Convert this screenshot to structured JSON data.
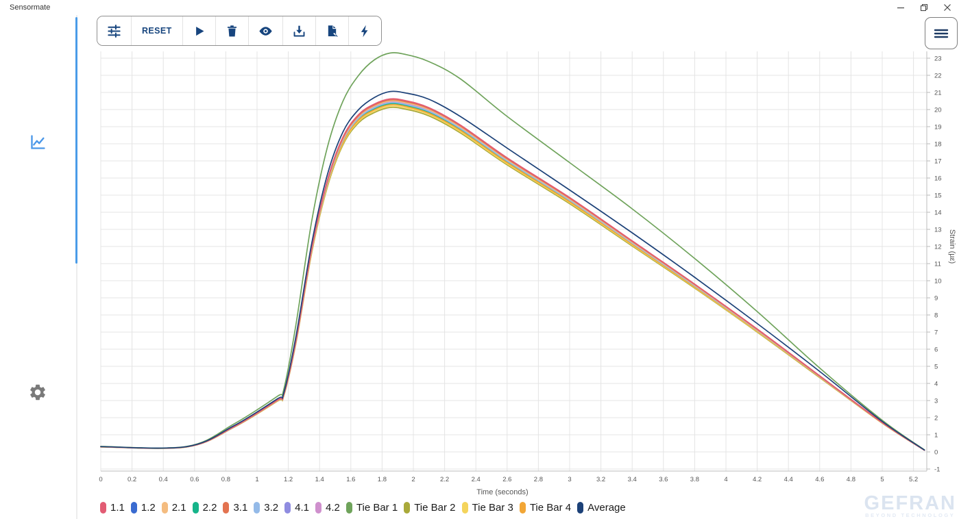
{
  "window": {
    "title": "Sensormate",
    "controls": {
      "minimize": "minimize",
      "restore": "restore-down",
      "close": "close"
    }
  },
  "sidebar": {
    "items": [
      {
        "id": "chart",
        "icon": "line-chart-icon",
        "active": true
      },
      {
        "id": "settings",
        "icon": "gear-icon",
        "active": false
      }
    ],
    "accent_color": "#4a9ce8"
  },
  "toolbar": {
    "reset_label": "RESET",
    "icon_color": "#17457e",
    "icons": [
      "tune-icon",
      "play-icon",
      "delete-icon",
      "visibility-icon",
      "download-icon",
      "file-export-icon",
      "bolt-icon"
    ]
  },
  "menu": {
    "icon": "hamburger-icon"
  },
  "watermark": {
    "brand": "GEFRAN",
    "tagline": "BEYOND TECHNOLOGY"
  },
  "chart_data": {
    "type": "line",
    "title": "",
    "xlabel": "Time (seconds)",
    "ylabel": "Strain (µε)",
    "xlim": [
      0,
      5.3
    ],
    "ylim": [
      -1,
      23.4
    ],
    "grid": true,
    "legend_position": "bottom",
    "grid_color": "#e4e4e4",
    "axis_color": "#c9c9c9",
    "tick_label_color": "#555555",
    "x_ticks": [
      0,
      0.2,
      0.4,
      0.6,
      0.8,
      1,
      1.2,
      1.4,
      1.6,
      1.8,
      2,
      2.2,
      2.4,
      2.6,
      2.8,
      3,
      3.2,
      3.4,
      3.6,
      3.8,
      4,
      4.2,
      4.4,
      4.6,
      4.8,
      5,
      5.2
    ],
    "x_tick_labels": [
      "0",
      "0.2",
      "0.4",
      "0.6",
      "0.8",
      "1",
      "1.2",
      "1.4",
      "1.6",
      "1.8",
      "2",
      "2.2",
      "2.4",
      "2.6",
      "2.8",
      "3",
      "3.2",
      "3.4",
      "3.6",
      "3.8",
      "4",
      "4.2",
      "4.4",
      "4.6",
      "4.8",
      "5",
      "5.2"
    ],
    "y_ticks": [
      -1,
      0,
      1,
      2,
      3,
      4,
      5,
      6,
      7,
      8,
      9,
      10,
      11,
      12,
      13,
      14,
      15,
      16,
      17,
      18,
      19,
      20,
      21,
      22,
      23
    ],
    "y_tick_labels": [
      "-1",
      "0",
      "1",
      "2",
      "3",
      "4",
      "5",
      "6",
      "7",
      "8",
      "9",
      "10",
      "11",
      "12",
      "13",
      "14",
      "15",
      "16",
      "17",
      "18",
      "19",
      "20",
      "21",
      "22",
      "23"
    ],
    "x": [
      0,
      0.55,
      0.85,
      1.13,
      1.17,
      1.25,
      1.35,
      1.45,
      1.55,
      1.65,
      1.75,
      1.85,
      1.95,
      2.1,
      2.3,
      2.6,
      3.0,
      3.4,
      3.8,
      4.2,
      4.6,
      5.0,
      5.27
    ],
    "series": [
      {
        "name": "1.2",
        "color": "#3a6bd0",
        "width": 1.8,
        "values": [
          0.3,
          0.3,
          1.45,
          3.0,
          3.3,
          6.49,
          11.78,
          15.68,
          18.17,
          19.47,
          20.07,
          20.37,
          20.27,
          19.87,
          18.87,
          16.98,
          14.68,
          12.18,
          9.69,
          7.09,
          4.39,
          1.7,
          0.1
        ]
      },
      {
        "name": "2.2",
        "color": "#16b48a",
        "width": 1.8,
        "values": [
          0.3,
          0.3,
          1.45,
          2.99,
          3.29,
          6.48,
          11.77,
          15.65,
          18.15,
          19.44,
          20.04,
          20.34,
          20.24,
          19.84,
          18.84,
          16.95,
          14.66,
          12.16,
          9.67,
          7.08,
          4.39,
          1.7,
          0.1
        ]
      },
      {
        "name": "4.1",
        "color": "#8f8ce0",
        "width": 1.8,
        "values": [
          0.3,
          0.3,
          1.45,
          3.01,
          3.31,
          6.51,
          11.82,
          15.73,
          18.24,
          19.54,
          20.14,
          20.44,
          20.34,
          19.94,
          18.94,
          17.03,
          14.73,
          12.22,
          9.72,
          7.11,
          4.41,
          1.7,
          0.1
        ]
      },
      {
        "name": "4.2",
        "color": "#cf90cd",
        "width": 1.8,
        "values": [
          0.3,
          0.3,
          1.45,
          3.01,
          3.31,
          6.52,
          11.84,
          15.75,
          18.26,
          19.57,
          20.17,
          20.47,
          20.37,
          19.97,
          18.96,
          17.06,
          14.75,
          12.24,
          9.73,
          7.12,
          4.42,
          1.71,
          0.1
        ]
      },
      {
        "name": "Tie Bar 2",
        "color": "#a9a93a",
        "width": 1.8,
        "values": [
          0.29,
          0.29,
          1.43,
          2.96,
          3.25,
          6.41,
          11.64,
          15.48,
          17.95,
          19.23,
          19.82,
          20.12,
          20.02,
          19.63,
          18.64,
          16.77,
          14.5,
          12.03,
          9.57,
          7.0,
          4.34,
          1.68,
          0.1
        ]
      },
      {
        "name": "Tie Bar 3",
        "color": "#f4d45c",
        "width": 1.8,
        "values": [
          0.3,
          0.3,
          1.44,
          2.97,
          3.27,
          6.44,
          11.68,
          15.55,
          18.02,
          19.31,
          19.9,
          20.2,
          20.1,
          19.71,
          18.71,
          16.83,
          14.56,
          12.08,
          9.61,
          7.03,
          4.36,
          1.68,
          0.1
        ]
      },
      {
        "name": "Tie Bar 4",
        "color": "#f2a636",
        "width": 1.8,
        "values": [
          0.3,
          0.3,
          1.44,
          2.98,
          3.28,
          6.46,
          11.73,
          15.61,
          18.09,
          19.39,
          19.98,
          20.28,
          20.18,
          19.78,
          18.79,
          16.9,
          14.61,
          12.13,
          9.64,
          7.06,
          4.37,
          1.69,
          0.1
        ]
      },
      {
        "name": "3.2",
        "color": "#94bae8",
        "width": 1.8,
        "values": [
          0.3,
          0.3,
          1.45,
          3.0,
          3.3,
          6.5,
          11.8,
          15.7,
          18.2,
          19.5,
          20.1,
          20.4,
          20.3,
          19.9,
          18.9,
          17.0,
          14.7,
          12.2,
          9.7,
          7.1,
          4.4,
          1.7,
          0.1
        ]
      },
      {
        "name": "2.1",
        "color": "#f4bc80",
        "width": 1.8,
        "values": [
          0.3,
          0.3,
          1.46,
          3.01,
          3.32,
          6.53,
          11.86,
          15.78,
          18.29,
          19.6,
          20.2,
          20.5,
          20.4,
          20.0,
          18.99,
          17.08,
          14.77,
          12.26,
          9.75,
          7.13,
          4.42,
          1.71,
          0.1
        ]
      },
      {
        "name": "3.1",
        "color": "#e37350",
        "width": 1.8,
        "values": [
          0.3,
          0.3,
          1.46,
          3.02,
          3.33,
          6.55,
          11.89,
          15.82,
          18.34,
          19.65,
          20.26,
          20.56,
          20.46,
          20.06,
          19.05,
          17.13,
          14.82,
          12.3,
          9.78,
          7.16,
          4.43,
          1.71,
          0.1
        ]
      },
      {
        "name": "1.1",
        "color": "#e25c74",
        "width": 1.8,
        "values": [
          0.3,
          0.3,
          1.47,
          3.03,
          3.34,
          6.57,
          11.93,
          15.87,
          18.4,
          19.71,
          20.32,
          20.62,
          20.52,
          20.11,
          19.1,
          17.18,
          14.86,
          12.33,
          9.8,
          7.18,
          4.45,
          1.72,
          0.1
        ]
      },
      {
        "name": "Tie Bar 1",
        "color": "#6fa35b",
        "width": 1.7,
        "values": [
          0.32,
          0.32,
          1.62,
          3.25,
          3.62,
          7.5,
          13.5,
          17.8,
          20.5,
          22.0,
          22.9,
          23.3,
          23.22,
          22.8,
          21.8,
          19.6,
          16.9,
          14.2,
          11.3,
          8.2,
          4.9,
          1.85,
          0.12
        ]
      },
      {
        "name": "Average",
        "color": "#1c4178",
        "width": 1.7,
        "values": [
          0.31,
          0.31,
          1.52,
          3.1,
          3.42,
          6.8,
          12.2,
          16.2,
          18.7,
          20.0,
          20.7,
          21.05,
          20.97,
          20.6,
          19.6,
          17.75,
          15.3,
          12.8,
          10.2,
          7.5,
          4.7,
          1.78,
          0.11
        ]
      }
    ],
    "legend_order": [
      "1.1",
      "1.2",
      "2.1",
      "2.2",
      "3.1",
      "3.2",
      "4.1",
      "4.2",
      "Tie Bar 1",
      "Tie Bar 2",
      "Tie Bar 3",
      "Tie Bar 4",
      "Average"
    ]
  }
}
